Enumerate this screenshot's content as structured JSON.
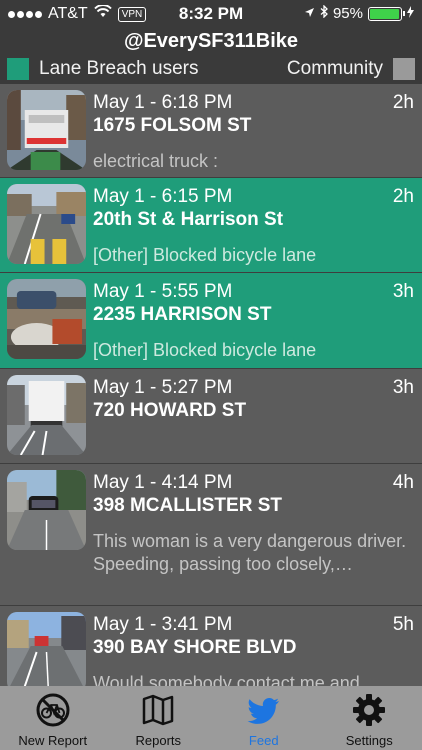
{
  "status_bar": {
    "carrier": "AT&T",
    "vpn": "VPN",
    "time": "8:32 PM",
    "battery": "95%",
    "battery_level": 0.95,
    "battery_color": "#3fd24a"
  },
  "header": {
    "title": "@EverySF311Bike"
  },
  "filters": {
    "left_label": "Lane Breach users",
    "left_color": "#1f9d7a",
    "right_label": "Community",
    "right_color": "#9a9a9a"
  },
  "feed": {
    "items": [
      {
        "date": "May 1 - 6:18 PM",
        "age": "2h",
        "address": "1675 FOLSOM ST",
        "description": "electrical truck :",
        "source": "community"
      },
      {
        "date": "May 1 - 6:15 PM",
        "age": "2h",
        "address": "20th St & Harrison St",
        "description": "[Other] Blocked bicycle lane",
        "source": "lane-breach"
      },
      {
        "date": "May 1 - 5:55 PM",
        "age": "3h",
        "address": "2235 HARRISON ST",
        "description": "[Other] Blocked bicycle lane",
        "source": "lane-breach"
      },
      {
        "date": "May 1 - 5:27 PM",
        "age": "3h",
        "address": "720 HOWARD ST",
        "description": "",
        "source": "community"
      },
      {
        "date": "May 1 - 4:14 PM",
        "age": "4h",
        "address": "398 MCALLISTER ST",
        "description": "This woman is a very dangerous driver. Speeding, passing too closely,…",
        "source": "community"
      },
      {
        "date": "May 1 - 3:41 PM",
        "age": "5h",
        "address": "390 BAY SHORE BLVD",
        "description": "Would somebody contact me and",
        "source": "community"
      }
    ]
  },
  "tabs": [
    {
      "label": "New Report",
      "icon": "no-bike-icon",
      "active": false
    },
    {
      "label": "Reports",
      "icon": "map-icon",
      "active": false
    },
    {
      "label": "Feed",
      "icon": "twitter-bird-icon",
      "active": true
    },
    {
      "label": "Settings",
      "icon": "gear-icon",
      "active": false
    }
  ],
  "colors": {
    "accent_green": "#1f9d7a",
    "active_tab": "#1d75e0",
    "feed_background": "#5c5c5c"
  }
}
